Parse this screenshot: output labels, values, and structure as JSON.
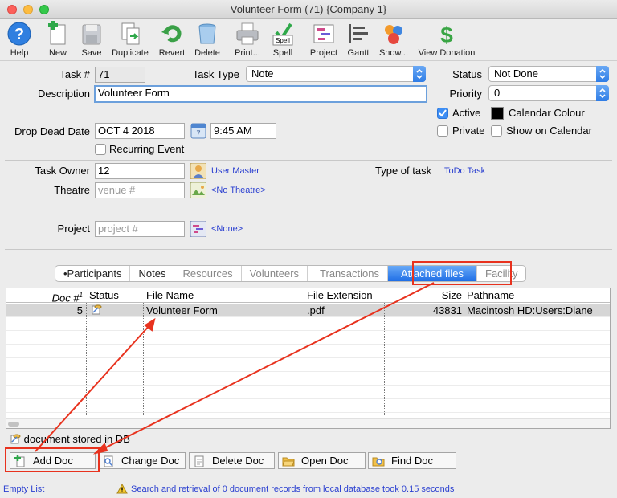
{
  "window": {
    "title": "Volunteer Form (71) {Company 1}"
  },
  "toolbar": {
    "help": "Help",
    "new": "New",
    "save": "Save",
    "duplicate": "Duplicate",
    "revert": "Revert",
    "delete": "Delete",
    "print": "Print...",
    "spell": "Spell",
    "spell_badge": "Spell",
    "project": "Project",
    "gantt": "Gantt",
    "show": "Show...",
    "view_donation": "View Donation"
  },
  "form": {
    "task_no_label": "Task #",
    "task_no": "71",
    "task_type_label": "Task Type",
    "task_type": "Note",
    "status_label": "Status",
    "status": "Not Done",
    "description_label": "Description",
    "description": "Volunteer Form",
    "priority_label": "Priority",
    "priority": "0",
    "active_label": "Active",
    "calendar_colour_label": "Calendar Colour",
    "private_label": "Private",
    "show_on_calendar_label": "Show on Calendar",
    "drop_dead_date_label": "Drop Dead Date",
    "drop_dead_date": "OCT 4 2018",
    "drop_dead_time": "9:45 AM",
    "recurring_label": "Recurring Event",
    "task_owner_label": "Task Owner",
    "task_owner": "12",
    "task_owner_name": "User Master",
    "type_of_task_label": "Type of task",
    "type_of_task": "ToDo Task",
    "theatre_label": "Theatre",
    "theatre_placeholder": "venue #",
    "theatre_name": "<No Theatre>",
    "project_label": "Project",
    "project_placeholder": "project #",
    "project_name": "<None>"
  },
  "tabs": [
    {
      "label": "•Participants"
    },
    {
      "label": "Notes"
    },
    {
      "label": "Resources"
    },
    {
      "label": "Volunteers"
    },
    {
      "label": "Transactions"
    },
    {
      "label": "Attached files"
    },
    {
      "label": "Facility"
    }
  ],
  "grid": {
    "headers": {
      "doc": "Doc #",
      "doc_sort": "1",
      "status": "Status",
      "file_name": "File Name",
      "file_extension": "File Extension",
      "size": "Size",
      "pathname": "Pathname"
    },
    "rows": [
      {
        "doc": "5",
        "file_name": "Volunteer Form",
        "file_extension": ".pdf",
        "size": "43831",
        "pathname": "Macintosh HD:Users:Diane"
      }
    ]
  },
  "legend": {
    "stored_in_db": "document stored in DB"
  },
  "buttons": {
    "add_doc": "Add Doc",
    "change_doc": "Change Doc",
    "delete_doc": "Delete Doc",
    "open_doc": "Open Doc",
    "find_doc": "Find Doc"
  },
  "statusbar": {
    "left": "Empty List",
    "message": "Search and retrieval of 0 document records from local database took 0.15 seconds"
  },
  "colors": {
    "accent": "#3d8ef5",
    "annotation": "#e8321e",
    "link": "#2a3fd0"
  }
}
